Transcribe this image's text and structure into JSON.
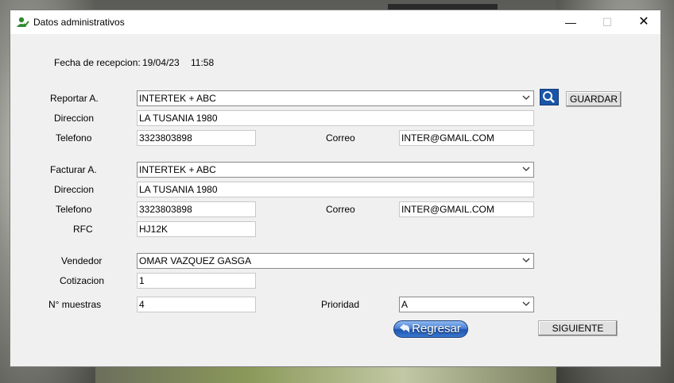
{
  "window": {
    "title": "Datos administrativos"
  },
  "reception": {
    "label": "Fecha de recepcion:",
    "date": "19/04/23",
    "time": "11:58"
  },
  "reportar": {
    "label": "Reportar A.",
    "value": "INTERTEK + ABC",
    "direccion_label": "Direccion",
    "direccion": "LA TUSANIA 1980",
    "telefono_label": "Telefono",
    "telefono": "3323803898",
    "correo_label": "Correo",
    "correo": "INTER@GMAIL.COM"
  },
  "facturar": {
    "label": "Facturar A.",
    "value": "INTERTEK + ABC",
    "direccion_label": "Direccion",
    "direccion": "LA TUSANIA 1980",
    "telefono_label": "Telefono",
    "telefono": "3323803898",
    "correo_label": "Correo",
    "correo": "INTER@GMAIL.COM",
    "rfc_label": "RFC",
    "rfc": "HJ12K"
  },
  "vendedor": {
    "label": "Vendedor",
    "value": "OMAR VAZQUEZ GASGA"
  },
  "cotizacion": {
    "label": "Cotizacion",
    "value": "1"
  },
  "muestras": {
    "label": "N° muestras",
    "value": "4"
  },
  "prioridad": {
    "label": "Prioridad",
    "value": "A"
  },
  "buttons": {
    "guardar": "GUARDAR",
    "regresar": "Regresar",
    "siguiente": "SIGUIENTE"
  },
  "colors": {
    "search_button": "#1a56a8",
    "regresar_button": "#3a78d0",
    "window_bg": "#f0f0f0"
  },
  "icons": [
    "app-user-icon",
    "search-icon",
    "back-arrow-icon",
    "chevron-down-icon",
    "minimize-icon",
    "maximize-icon",
    "close-icon"
  ]
}
